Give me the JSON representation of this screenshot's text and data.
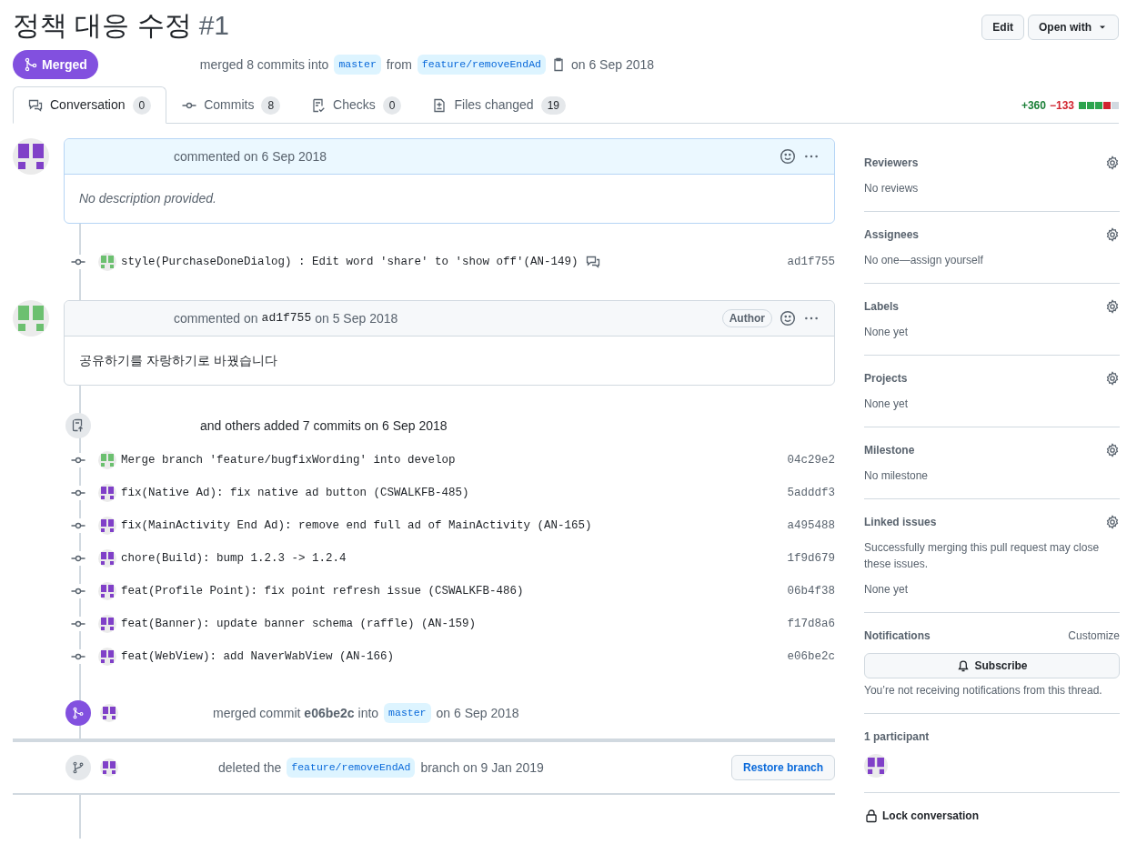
{
  "title": {
    "text": "정책 대응 수정",
    "number": "#1"
  },
  "header_buttons": [
    {
      "label": "Edit",
      "caret": false
    },
    {
      "label": "Open with",
      "caret": true
    }
  ],
  "state_badge": {
    "label": "Merged"
  },
  "summary": [
    {
      "kind": "text",
      "text": "merged 8 commits into"
    },
    {
      "kind": "branch",
      "text": "master"
    },
    {
      "kind": "text",
      "text": "from"
    },
    {
      "kind": "branch",
      "text": "feature/removeEndAd"
    },
    {
      "kind": "copy"
    },
    {
      "kind": "text",
      "text": "on 6 Sep 2018"
    }
  ],
  "tabs": [
    {
      "label": "Conversation",
      "count": "0",
      "selected": true
    },
    {
      "label": "Commits",
      "count": "8",
      "selected": false
    },
    {
      "label": "Checks",
      "count": "0",
      "selected": false
    },
    {
      "label": "Files changed",
      "count": "19",
      "selected": false
    }
  ],
  "diffstat": {
    "added": "+360",
    "removed": "−133",
    "blocks": [
      {
        "kind": "added"
      },
      {
        "kind": "added"
      },
      {
        "kind": "added"
      },
      {
        "kind": "removed"
      },
      {
        "kind": "neutral"
      }
    ]
  },
  "timeline": [
    {
      "kind": "comment",
      "color": "#8040c8",
      "highlighted": true,
      "header": [
        {
          "kind": "text",
          "text": "commented on 6 Sep 2018"
        }
      ],
      "body": "No description provided.",
      "italic": true
    },
    {
      "kind": "commit",
      "color": "#6cc070",
      "message": "style(PurchaseDoneDialog) : Edit word 'share' to 'show off'(AN-149)",
      "has_comments": true,
      "sha": "ad1f755"
    },
    {
      "kind": "comment",
      "color": "#6cc070",
      "highlighted": false,
      "header": [
        {
          "kind": "text",
          "text": "commented on"
        },
        {
          "kind": "code",
          "text": "ad1f755"
        },
        {
          "kind": "text",
          "text": "on 5 Sep 2018"
        }
      ],
      "author_badge": "Author",
      "body": "공유하기를 자랑하기로 바꿨습니다",
      "italic": false
    },
    {
      "kind": "group",
      "text": "and others added 7 commits on 6 Sep 2018"
    },
    {
      "kind": "commit",
      "color": "#6cc070",
      "message": "Merge branch 'feature/bugfixWording' into develop",
      "has_comments": false,
      "sha": "04c29e2"
    },
    {
      "kind": "commit",
      "color": "#8040c8",
      "message": "fix(Native Ad): fix native ad button (CSWALKFB-485)",
      "has_comments": false,
      "sha": "5adddf3"
    },
    {
      "kind": "commit",
      "color": "#8040c8",
      "message": "fix(MainActivity End Ad): remove end full ad of MainActivity (AN-165)",
      "has_comments": false,
      "sha": "a495488"
    },
    {
      "kind": "commit",
      "color": "#8040c8",
      "message": "chore(Build): bump 1.2.3 -> 1.2.4",
      "has_comments": false,
      "sha": "1f9d679"
    },
    {
      "kind": "commit",
      "color": "#8040c8",
      "message": "feat(Profile Point): fix point refresh issue (CSWALKFB-486)",
      "has_comments": false,
      "sha": "06b4f38"
    },
    {
      "kind": "commit",
      "color": "#8040c8",
      "message": "feat(Banner): update banner schema (raffle) (AN-159)",
      "has_comments": false,
      "sha": "f17d8a6"
    },
    {
      "kind": "commit",
      "color": "#8040c8",
      "message": "feat(WebView): add NaverWabView (AN-166)",
      "has_comments": false,
      "sha": "e06be2c"
    },
    {
      "kind": "merged",
      "color": "#8040c8",
      "segments": [
        {
          "kind": "rich",
          "text": "merged commit **e06be2c** into"
        },
        {
          "kind": "branch",
          "text": "master"
        },
        {
          "kind": "text",
          "text": "on 6 Sep 2018"
        }
      ]
    },
    {
      "kind": "deleted",
      "color": "#8040c8",
      "segments": [
        {
          "kind": "text",
          "text": "deleted the"
        },
        {
          "kind": "branch",
          "text": "feature/removeEndAd"
        },
        {
          "kind": "text",
          "text": "branch on 9 Jan 2019"
        }
      ],
      "button": "Restore branch"
    }
  ],
  "sidebar": [
    {
      "kind": "setting",
      "heading": "Reviewers",
      "lines": [
        "No reviews"
      ]
    },
    {
      "kind": "setting",
      "heading": "Assignees",
      "lines": [
        "No one—assign yourself"
      ]
    },
    {
      "kind": "setting",
      "heading": "Labels",
      "lines": [
        "None yet"
      ]
    },
    {
      "kind": "setting",
      "heading": "Projects",
      "lines": [
        "None yet"
      ]
    },
    {
      "kind": "setting",
      "heading": "Milestone",
      "lines": [
        "No milestone"
      ]
    },
    {
      "kind": "setting",
      "heading": "Linked issues",
      "lines": [
        "Successfully merging this pull request may close these issues.",
        "None yet"
      ]
    },
    {
      "kind": "notifications",
      "heading": "Notifications",
      "link": "Customize",
      "button": "Subscribe",
      "lines": [
        "You’re not receiving notifications from this thread."
      ]
    },
    {
      "kind": "participants",
      "heading": "1 participant",
      "avatars": [
        {
          "color": "#8040c8"
        }
      ]
    },
    {
      "kind": "lock",
      "label": "Lock conversation"
    }
  ]
}
